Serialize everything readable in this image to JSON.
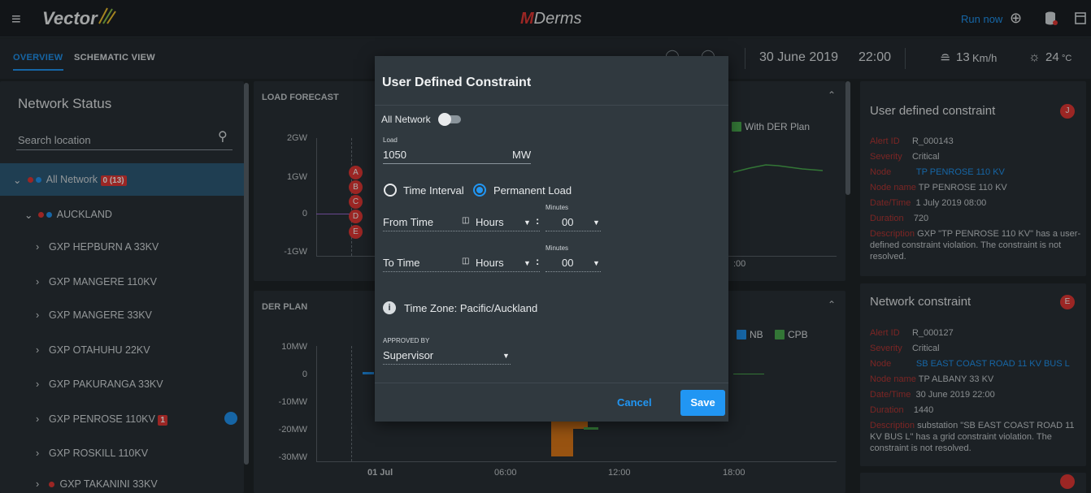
{
  "app": {
    "brand": "Vector",
    "title_prefix": "M",
    "title_rest": "Derms",
    "run_now": "Run now"
  },
  "tabs": [
    {
      "label": "OVERVIEW"
    },
    {
      "label": "SCHEMATIC VIEW"
    }
  ],
  "status": {
    "date": "30 June 2019",
    "time": "22:00",
    "wind": "13",
    "wind_unit": "Km/h",
    "temp": "24",
    "temp_unit": "°C"
  },
  "sidebar": {
    "title": "Network Status",
    "search_placeholder": "Search location",
    "items": [
      {
        "label": "All Network",
        "badge": "0 (13)"
      },
      {
        "label": "AUCKLAND"
      },
      {
        "label": "GXP HEPBURN A 33KV"
      },
      {
        "label": "GXP MANGERE 110KV"
      },
      {
        "label": "GXP MANGERE 33KV"
      },
      {
        "label": "GXP OTAHUHU 22KV"
      },
      {
        "label": "GXP PAKURANGA 33KV"
      },
      {
        "label": "GXP PENROSE 110KV",
        "badge": "1"
      },
      {
        "label": "GXP ROSKILL 110KV"
      },
      {
        "label": "GXP TAKANINI 33KV"
      }
    ]
  },
  "load_forecast": {
    "title": "LOAD FORECAST",
    "yticks": [
      "2GW",
      "1GW",
      "0",
      "-1GW"
    ],
    "legend": "With DER Plan",
    "markers": [
      "A",
      "B",
      "C",
      "D",
      "E"
    ],
    "xtick_partial": ":00"
  },
  "der_plan": {
    "title": "DER PLAN",
    "yticks": [
      "10MW",
      "0",
      "-10MW",
      "-20MW",
      "-30MW"
    ],
    "xticks": [
      "01 Jul",
      "06:00",
      "12:00",
      "18:00"
    ],
    "legend": [
      "NB",
      "CPB"
    ]
  },
  "alerts": [
    {
      "title": "User defined constraint",
      "badge": "J",
      "rows": [
        {
          "k": "Alert ID",
          "v": "R_000143"
        },
        {
          "k": "Severity",
          "v": "Critical"
        },
        {
          "k": "Node",
          "v": "TP PENROSE 110 KV"
        },
        {
          "k": "Node name",
          "v": "TP PENROSE 110 KV"
        },
        {
          "k": "Date/Time",
          "v": "1 July 2019 08:00"
        },
        {
          "k": "Duration",
          "v": "720"
        },
        {
          "k": "Description",
          "v": "GXP \"TP PENROSE 110 KV\" has a user-defined constraint violation. The constraint is not resolved."
        }
      ]
    },
    {
      "title": "Network constraint",
      "badge": "E",
      "rows": [
        {
          "k": "Alert ID",
          "v": "R_000127"
        },
        {
          "k": "Severity",
          "v": "Critical"
        },
        {
          "k": "Node",
          "v": "SB EAST COAST ROAD 11 KV BUS L"
        },
        {
          "k": "Node name",
          "v": "TP ALBANY 33 KV"
        },
        {
          "k": "Date/Time",
          "v": "30 June 2019 22:00"
        },
        {
          "k": "Duration",
          "v": "1440"
        },
        {
          "k": "Description",
          "v": "substation \"SB EAST COAST ROAD 11 KV BUS L\" has a grid constraint violation. The constraint is not resolved."
        }
      ]
    }
  ],
  "modal": {
    "title": "User Defined Constraint",
    "all_network": "All Network",
    "load_label": "Load",
    "load_value": "1050",
    "load_unit": "MW",
    "radio_interval": "Time Interval",
    "radio_permanent": "Permanent Load",
    "minutes_label": "Minutes",
    "from_time": "From Time",
    "to_time": "To Time",
    "hours": "Hours",
    "minutes_value": "00",
    "timezone": "Time Zone:  Pacific/Auckland",
    "approved_label": "APPROVED BY",
    "approved_value": "Supervisor",
    "cancel": "Cancel",
    "save": "Save"
  },
  "colors": {
    "accent": "#2196f3",
    "alert": "#e53935",
    "der_green": "#4caf50",
    "der_orange": "#e07b1a"
  }
}
